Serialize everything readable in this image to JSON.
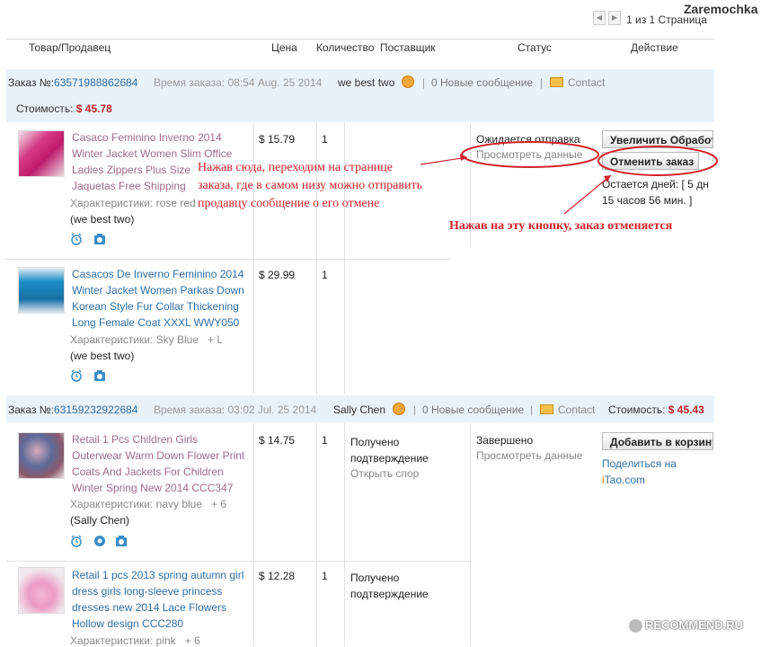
{
  "user": {
    "name": "Zaremochka"
  },
  "pager": {
    "text": "1 из 1 Страница"
  },
  "columns": [
    "Товар/Продавец",
    "Цена",
    "Количество",
    "Поставщик",
    "Статус",
    "Действие"
  ],
  "orders": [
    {
      "number_label": "Заказ №:",
      "number": "63571988862684",
      "time": "Время заказа: 08:54 Aug. 25 2014",
      "seller": "we best two",
      "messages": "0 Новые сообщение",
      "contact": "Contact",
      "cost_label": "Стоимость:",
      "cost": "$ 45.78",
      "items": [
        {
          "title_lines": [
            "Casaco Feminino Inverno 2014",
            "Winter Jacket Women Slim Office",
            "Ladies Zippers Plus Size",
            "Jaquetas Free Shipping"
          ],
          "props": "Характеристики: rose red",
          "seller": "(we best two)",
          "price": "$ 15.79",
          "qty": "1",
          "status": "Ожидается отправка",
          "status_link": "Просмотреть данные",
          "action1": "Увеличить Обработ",
          "action2": "Отменить заказ",
          "remaining": [
            "Остается дней: [ 5 дн",
            "15 часов 56 мин. ]"
          ]
        },
        {
          "title_lines": [
            "Casacos De Inverno Feminino 2014",
            "Winter Jacket Women Parkas Down",
            "Korean Style Fur Collar Thickening",
            "Long Female Coat XXXL WWY050"
          ],
          "props": "Характеристики: Sky Blue",
          "props_extra": "+ L",
          "seller": "(we best two)",
          "price": "$ 29.99",
          "qty": "1"
        }
      ]
    },
    {
      "number_label": "Заказ №:",
      "number": "63159232922684",
      "time": "Время заказа: 03:02 Jul. 25 2014",
      "seller": "Sally Chen",
      "messages": "0 Новые сообщение",
      "contact": "Contact",
      "cost_label": "Стоимость:",
      "cost": "$ 45.43",
      "items": [
        {
          "title_lines": [
            "Retail 1 Pcs Children Girls",
            "Outerwear Warm Down Flower Print",
            "Coats And Jackets For Children",
            "Winter Spring New 2014 CCC347"
          ],
          "props": "Характеристики: navy blue",
          "props_extra": "+ 6",
          "seller": "(Sally Chen)",
          "price": "$ 14.75",
          "qty": "1",
          "supplier_lines": [
            "Получено",
            "подтверждение"
          ],
          "supplier_link": "Открыть спор",
          "status": "Завершено",
          "status_link": "Просмотреть данные",
          "action1": "Добавить в корзину",
          "share_text": "Поделиться на",
          "share_brand_i": "i",
          "share_brand_tao": "Tao",
          "share_brand_com": ".com"
        },
        {
          "title_lines": [
            "Retail 1 pcs 2013 spring autumn girl",
            "dress girls long-sleeve princess",
            "dresses new 2014 Lace Flowers",
            "Hollow design CCC280"
          ],
          "props": "Характеристики: pink",
          "props_extra": "+ 6",
          "price": "$ 12.28",
          "qty": "1",
          "supplier_lines": [
            "Получено",
            "подтверждение"
          ]
        }
      ]
    }
  ],
  "annotations": {
    "note1": [
      "Нажав сюда, переходим на странице",
      "заказа, где в самом низу можно отправить",
      "продавцу сообщение о его отмене"
    ],
    "note2": "Нажав на эту кнопку, заказ отменяется"
  },
  "watermark": "RECOMMEND.RU",
  "colors": {
    "band": "#eaf2f9",
    "accent_red": "#c0252b",
    "annotation_red": "#d3232b",
    "link_blue": "#2f6ea5"
  }
}
